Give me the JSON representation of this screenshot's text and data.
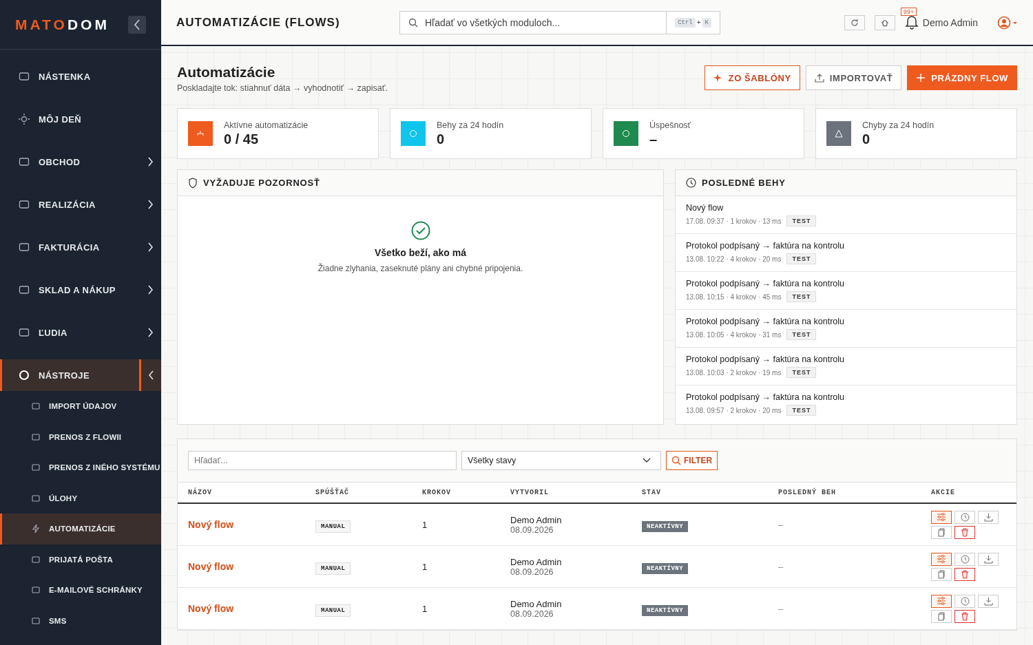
{
  "brand": {
    "part_1": "MATO",
    "part_2": "DOM"
  },
  "sidebar": {
    "items": [
      {
        "label": "NÁSTENKA",
        "selected": false
      },
      {
        "label": "MÔJ DEŇ",
        "selected": false
      },
      {
        "label": "OBCHOD",
        "expanded": false,
        "selected": false
      },
      {
        "label": "REALIZÁCIA",
        "expanded": false,
        "selected": false
      },
      {
        "label": "FAKTURÁCIA",
        "expanded": false,
        "selected": false
      },
      {
        "label": "SKLAD A NÁKUP",
        "expanded": false,
        "selected": false
      },
      {
        "label": "ĽUDIA",
        "expanded": false,
        "selected": false
      },
      {
        "label": "NÁSTROJE",
        "expanded": true,
        "selected": true,
        "children": [
          {
            "label": "IMPORT ÚDAJOV",
            "selected": false
          },
          {
            "label": "PRENOS Z FLOWII",
            "selected": false
          },
          {
            "label": "PRENOS Z INÉHO SYSTÉMU",
            "selected": false
          },
          {
            "label": "ÚLOHY",
            "selected": false
          },
          {
            "label": "AUTOMATIZÁCIE",
            "selected": true
          },
          {
            "label": "PRIJATÁ POŠTA",
            "selected": false
          },
          {
            "label": "E-MAILOVÉ SCHRÁNKY",
            "selected": false
          },
          {
            "label": "SMS",
            "selected": false
          }
        ]
      }
    ]
  },
  "header": {
    "title": "AUTOMATIZÁCIE (FLOWS)",
    "search": {
      "placeholder": "Hľadať vo všetkých moduloch...",
      "shortcut_1": "Ctrl",
      "shortcut_sep": "+",
      "shortcut_2": "K"
    },
    "notifications": "99+",
    "user": "Demo Admin"
  },
  "page": {
    "title": "Automatizácie",
    "subtitle": "Poskladajte tok: stiahnuť dáta → vyhodnotiť → zapisať.",
    "actions": [
      {
        "label": "ZO ŠABLÓNY",
        "kind": "outline"
      },
      {
        "label": "IMPORTOVAŤ",
        "kind": "neutral"
      },
      {
        "label": "PRÁZDNY FLOW",
        "kind": "primary"
      }
    ]
  },
  "stats": [
    {
      "label": "Aktívne automatizácie",
      "value": "0 / 45",
      "color": "#ef5a1f"
    },
    {
      "label": "Behy za 24 hodín",
      "value": "0",
      "color": "#0fc5ec"
    },
    {
      "label": "Úspešnosť",
      "value": "–",
      "color": "#1f8a4f"
    },
    {
      "label": "Chyby za 24 hodín",
      "value": "0",
      "color": "#6c737c"
    }
  ],
  "attention": {
    "title": "VYŽADUJE POZORNOSŤ",
    "empty_title": "Všetko beží, ako má",
    "empty_text": "Žiadne zlyhania, zaseknuté plány ani chybné pripojenia."
  },
  "recent": {
    "title": "POSLEDNÉ BEHY",
    "runs": [
      {
        "name": "Nový flow",
        "meta": "17.08. 09:37 · 1 krokov · 13 ms",
        "tag": "TEST"
      },
      {
        "name": "Protokol podpísaný → faktúra na kontrolu",
        "meta": "13.08. 10:22 · 4 krokov · 20 ms",
        "tag": "TEST"
      },
      {
        "name": "Protokol podpísaný → faktúra na kontrolu",
        "meta": "13.08. 10:15 · 4 krokov · 45 ms",
        "tag": "TEST"
      },
      {
        "name": "Protokol podpísaný → faktúra na kontrolu",
        "meta": "13.08. 10:05 · 4 krokov · 31 ms",
        "tag": "TEST"
      },
      {
        "name": "Protokol podpísaný → faktúra na kontrolu",
        "meta": "13.08. 10:03 · 2 krokov · 19 ms",
        "tag": "TEST"
      },
      {
        "name": "Protokol podpísaný → faktúra na kontrolu",
        "meta": "13.08. 09:57 · 2 krokov · 20 ms",
        "tag": "TEST"
      }
    ]
  },
  "filters": {
    "search_placeholder": "Hľadať...",
    "status": "Všetky stavy",
    "button": "FILTER"
  },
  "table": {
    "columns": [
      "NÁZOV",
      "SPÚŠŤAČ",
      "KROKOV",
      "VYTVORIL",
      "STAV",
      "POSLEDNÝ BEH",
      "AKCIE"
    ],
    "rows": [
      {
        "name": "Nový flow",
        "trigger": "MANUAL",
        "steps": "1",
        "author": "Demo Admin",
        "date": "08.09.2026",
        "status": "NEAKTÍVNY",
        "last_run": "–"
      },
      {
        "name": "Nový flow",
        "trigger": "MANUAL",
        "steps": "1",
        "author": "Demo Admin",
        "date": "08.09.2026",
        "status": "NEAKTÍVNY",
        "last_run": "–"
      },
      {
        "name": "Nový flow",
        "trigger": "MANUAL",
        "steps": "1",
        "author": "Demo Admin",
        "date": "08.09.2026",
        "status": "NEAKTÍVNY",
        "last_run": "–"
      }
    ]
  }
}
